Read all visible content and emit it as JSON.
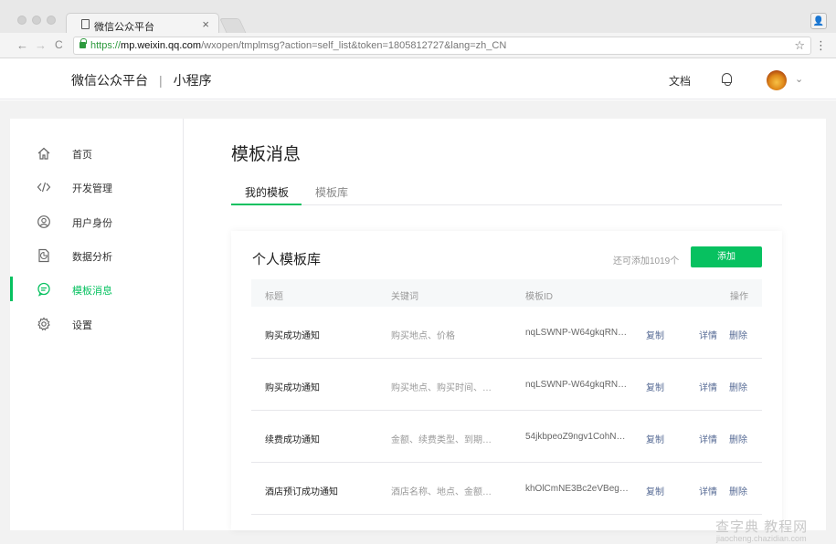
{
  "browser": {
    "tab_title": "微信公众平台",
    "tab_close": "×",
    "url_scheme": "https://",
    "url_host": "mp.weixin.qq.com",
    "url_path": "/wxopen/tmplmsg?action=self_list&token=1805812727&lang=zh_CN",
    "back": "←",
    "forward": "→",
    "reload": "C",
    "star": "☆",
    "menu": "⋮",
    "profile": "👤"
  },
  "header": {
    "brand": "微信公众平台",
    "separator": "|",
    "product": "小程序",
    "docs": "文档",
    "caret": "⌄"
  },
  "sidebar": {
    "items": [
      {
        "label": "首页",
        "icon": "home-icon"
      },
      {
        "label": "开发管理",
        "icon": "code-icon"
      },
      {
        "label": "用户身份",
        "icon": "user-icon"
      },
      {
        "label": "数据分析",
        "icon": "document-chart-icon"
      },
      {
        "label": "模板消息",
        "icon": "message-icon",
        "active": true
      },
      {
        "label": "设置",
        "icon": "gear-icon"
      }
    ]
  },
  "main": {
    "title": "模板消息",
    "tabs": [
      {
        "label": "我的模板",
        "active": true
      },
      {
        "label": "模板库",
        "active": false
      }
    ],
    "card": {
      "title": "个人模板库",
      "quota": "还可添加1019个",
      "add_button": "添加",
      "columns": {
        "title": "标题",
        "keywords": "关键词",
        "id": "模板ID",
        "actions": "操作"
      },
      "rows": [
        {
          "title": "购买成功通知",
          "keywords": "购买地点、价格",
          "id": "nqLSWNP-W64gkqRN…",
          "copy": "复制",
          "detail": "详情",
          "delete": "删除"
        },
        {
          "title": "购买成功通知",
          "keywords": "购买地点、购买时间、…",
          "id": "nqLSWNP-W64gkqRN…",
          "copy": "复制",
          "detail": "详情",
          "delete": "删除"
        },
        {
          "title": "续费成功通知",
          "keywords": "金额、续费类型、到期…",
          "id": "54jkbpeoZ9ngv1CohN…",
          "copy": "复制",
          "detail": "详情",
          "delete": "删除"
        },
        {
          "title": "酒店预订成功通知",
          "keywords": "酒店名称、地点、金额…",
          "id": "khOlCmNE3Bc2eVBeg…",
          "copy": "复制",
          "detail": "详情",
          "delete": "删除"
        }
      ]
    }
  },
  "watermark": {
    "text": "查字典 教程网",
    "sub": "jiaocheng.chazidian.com"
  },
  "colors": {
    "accent": "#07c160",
    "link": "#576b95",
    "muted": "#999999",
    "page_bg": "#f2f2f2"
  }
}
